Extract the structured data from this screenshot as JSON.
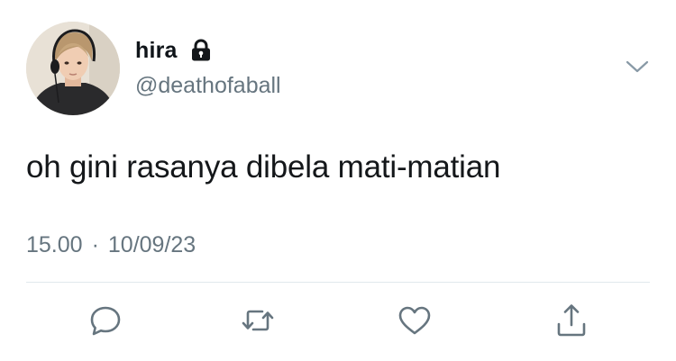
{
  "author": {
    "display_name": "hira",
    "handle": "@deathofaball",
    "protected_icon": "lock-icon",
    "avatar_description": "profile-photo"
  },
  "tweet": {
    "text": "oh gini rasanya dibela mati-matian",
    "time": "15.00",
    "separator": "·",
    "date": "10/09/23"
  },
  "menu_icon": "chevron-down-icon",
  "actions": [
    {
      "name": "reply",
      "icon": "speech-bubble-icon"
    },
    {
      "name": "retweet",
      "icon": "retweet-arrows-icon"
    },
    {
      "name": "like",
      "icon": "heart-icon"
    },
    {
      "name": "share",
      "icon": "share-arrow-up-icon"
    }
  ],
  "colors": {
    "text_primary": "#14171a",
    "text_secondary": "#66757f",
    "divider": "#e1e8ed",
    "icon": "#66757f"
  }
}
